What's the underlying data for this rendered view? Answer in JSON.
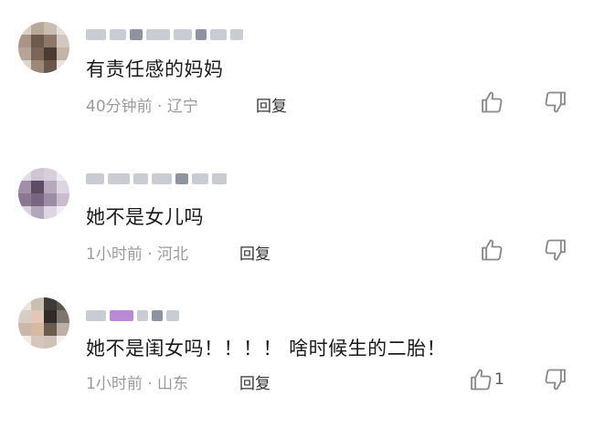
{
  "comments": [
    {
      "content": "有责任感的妈妈",
      "time": "40分钟前",
      "location": "辽宁",
      "reply_label": "回复",
      "like_count": ""
    },
    {
      "content": "她不是女儿吗",
      "time": "1小时前",
      "location": "河北",
      "reply_label": "回复",
      "like_count": ""
    },
    {
      "content": "她不是闺女吗！！！！ 啥时候生的二胎！",
      "time": "1小时前",
      "location": "山东",
      "reply_label": "回复",
      "like_count": "1"
    }
  ],
  "separator": " · ",
  "icons": [
    "thumbs-up-icon",
    "thumbs-down-icon"
  ],
  "colors": {
    "meta": "#9a9a9a",
    "text": "#1a1a1a",
    "icon": "#8a8a8a"
  }
}
